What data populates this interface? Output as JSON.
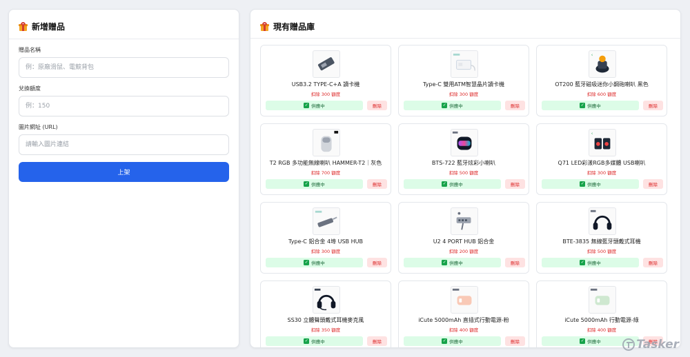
{
  "add_panel": {
    "title": "新增贈品",
    "icon": "gift-icon",
    "fields": [
      {
        "label": "贈品名稱",
        "placeholder": "例：原廠滑鼠、電競背包",
        "value": ""
      },
      {
        "label": "兌換額度",
        "placeholder": "例：150",
        "value": ""
      },
      {
        "label": "圖片網址 (URL)",
        "placeholder": "請輸入圖片連結",
        "value": ""
      }
    ],
    "submit_label": "上架"
  },
  "list_panel": {
    "title": "現有贈品庫",
    "icon": "gift-icon",
    "items": [
      {
        "name": "USB3.2 TYPE-C+A 讀卡機",
        "price": "扣除 300 額度",
        "status": "供應中",
        "delete": "刪除",
        "image": "card-reader"
      },
      {
        "name": "Type-C 雙用ATM智慧晶片讀卡機",
        "price": "扣除 300 額度",
        "status": "供應中",
        "delete": "刪除",
        "image": "atm-reader"
      },
      {
        "name": "OT200 藍牙磁吸迷你小鋼砲喇叭 黑色",
        "price": "扣除 600 額度",
        "status": "供應中",
        "delete": "刪除",
        "image": "mini-speaker"
      },
      {
        "name": "T2 RGB 多功能無線喇叭 HAMMER-T2｜灰色",
        "price": "扣除 700 額度",
        "status": "供應中",
        "delete": "刪除",
        "image": "gray-speaker"
      },
      {
        "name": "BTS-722 藍牙炫彩小喇叭",
        "price": "扣除 500 額度",
        "status": "供應中",
        "delete": "刪除",
        "image": "rgb-speaker"
      },
      {
        "name": "Q71 LED彩漾RGB多媒體 USB喇叭",
        "price": "扣除 300 額度",
        "status": "供應中",
        "delete": "刪除",
        "image": "dual-speaker"
      },
      {
        "name": "Type-C 鋁合金 4埠 USB HUB",
        "price": "扣除 300 額度",
        "status": "供應中",
        "delete": "刪除",
        "image": "usb-hub"
      },
      {
        "name": "U2 4 PORT HUB 鋁合金",
        "price": "扣除 200 額度",
        "status": "供應中",
        "delete": "刪除",
        "image": "usb-hub-2"
      },
      {
        "name": "BTE-3835 無線藍牙頭戴式耳機",
        "price": "扣除 500 額度",
        "status": "供應中",
        "delete": "刪除",
        "image": "headphones"
      },
      {
        "name": "SS30 立體聲頭戴式耳機麥克風",
        "price": "扣除 350 額度",
        "status": "供應中",
        "delete": "刪除",
        "image": "headset"
      },
      {
        "name": "iCute 5000mAh 直插式行動電源-粉",
        "price": "扣除 400 額度",
        "status": "供應中",
        "delete": "刪除",
        "image": "powerbank-pink"
      },
      {
        "name": "iCute 5000mAh 行動電源-綠",
        "price": "扣除 400 額度",
        "status": "供應中",
        "delete": "刪除",
        "image": "powerbank-green"
      }
    ]
  },
  "watermark": "Tasker",
  "colors": {
    "primary": "#2563eb",
    "status_bg": "#dcfce7",
    "status_text": "#166534",
    "danger": "#dc2626",
    "danger_bg": "#fee2e2"
  }
}
